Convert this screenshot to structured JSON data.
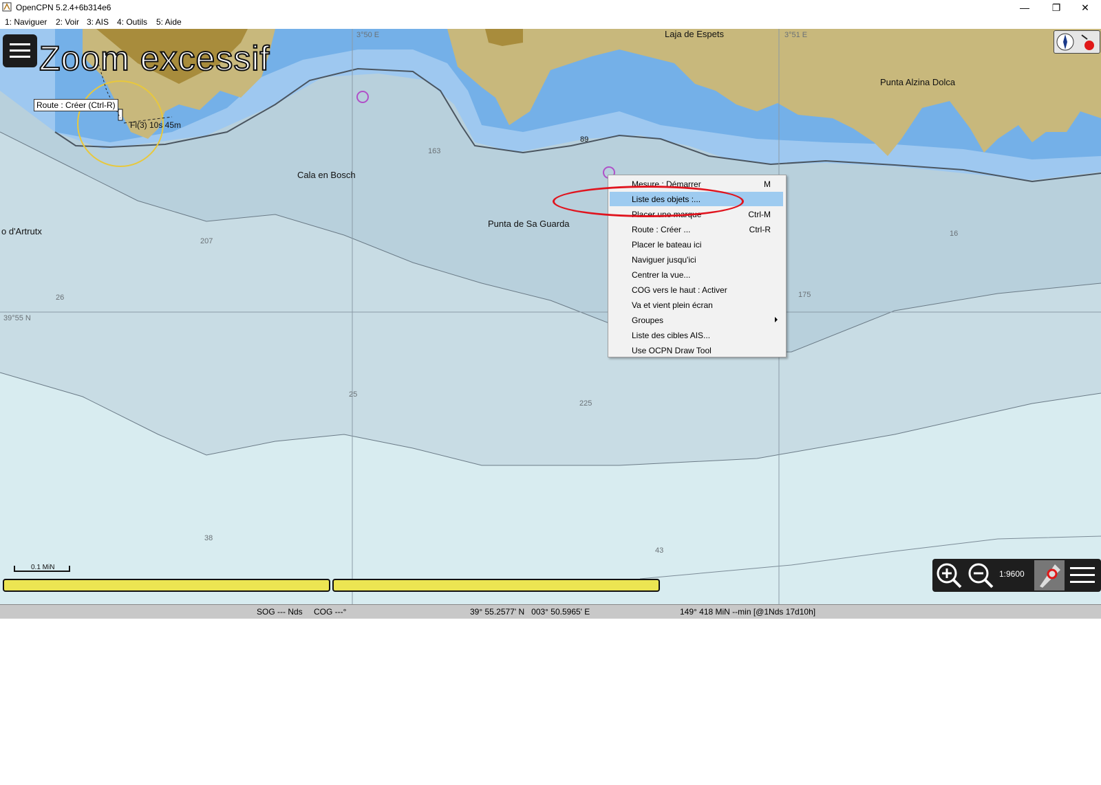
{
  "window": {
    "title": "OpenCPN 5.2.4+6b314e6",
    "controls": {
      "minimize": "—",
      "restore": "❐",
      "close": "✕"
    }
  },
  "menu": [
    "1: Naviguer",
    "2: Voir",
    "3: AIS",
    "4: Outils",
    "5: Aide"
  ],
  "chart": {
    "warning": "Zoom excessif",
    "tooltip": "Route : Créer (Ctrl-R)",
    "light_label": "Fl(3) 10s 45m",
    "places": {
      "laja": "Laja de Espets",
      "alzina": "Punta Alzina Dolca",
      "cala": "Cala en Bosch",
      "guarda": "Punta de Sa Guarda",
      "artrutx": "o d'Artrutx"
    },
    "grid_labels": {
      "lon1": "3°50 E",
      "lon2": "3°51 E",
      "lat": "39°55 N"
    },
    "soundings": {
      "s89": "89",
      "s163": "163",
      "s207": "207",
      "s26": "26",
      "s16": "16",
      "s175": "175",
      "s25": "25",
      "s225": "225",
      "s38": "38",
      "s43": "43"
    },
    "scale_bar": "0.1 MiN",
    "scale_reading": "1:9600"
  },
  "context_menu": [
    {
      "label": "Mesure : Démarrer",
      "shortcut": "M"
    },
    {
      "label": "Liste des objets :...",
      "shortcut": ""
    },
    {
      "label": "Placer une marque",
      "shortcut": "Ctrl-M"
    },
    {
      "label": "Route : Créer ...",
      "shortcut": "Ctrl-R"
    },
    {
      "label": "Placer le bateau ici",
      "shortcut": ""
    },
    {
      "label": "Naviguer jusqu'ici",
      "shortcut": ""
    },
    {
      "label": "Centrer la vue...",
      "shortcut": ""
    },
    {
      "label": "COG vers le haut : Activer",
      "shortcut": ""
    },
    {
      "label": "Va et vient plein écran",
      "shortcut": ""
    },
    {
      "label": "Groupes",
      "shortcut": ""
    },
    {
      "label": "Liste des cibles AIS...",
      "shortcut": ""
    },
    {
      "label": "Use OCPN Draw Tool",
      "shortcut": ""
    }
  ],
  "status": {
    "sog": "SOG --- Nds",
    "cog": "COG ---°",
    "position": "39° 55.2577' N   003° 50.5965' E",
    "bearing": "149°  418 MiN --min [@1Nds 17d10h]"
  },
  "colors": {
    "land": "#c8b87c",
    "land_built": "#a88c3c",
    "shallow": "#74b0e8",
    "mid": "#9ec8f0",
    "deep": "#b8d0dc",
    "deeper": "#c8dce4",
    "deepest": "#d8ecf0",
    "highlight": "#9ecbf0",
    "annotation_red": "#e0141e"
  }
}
